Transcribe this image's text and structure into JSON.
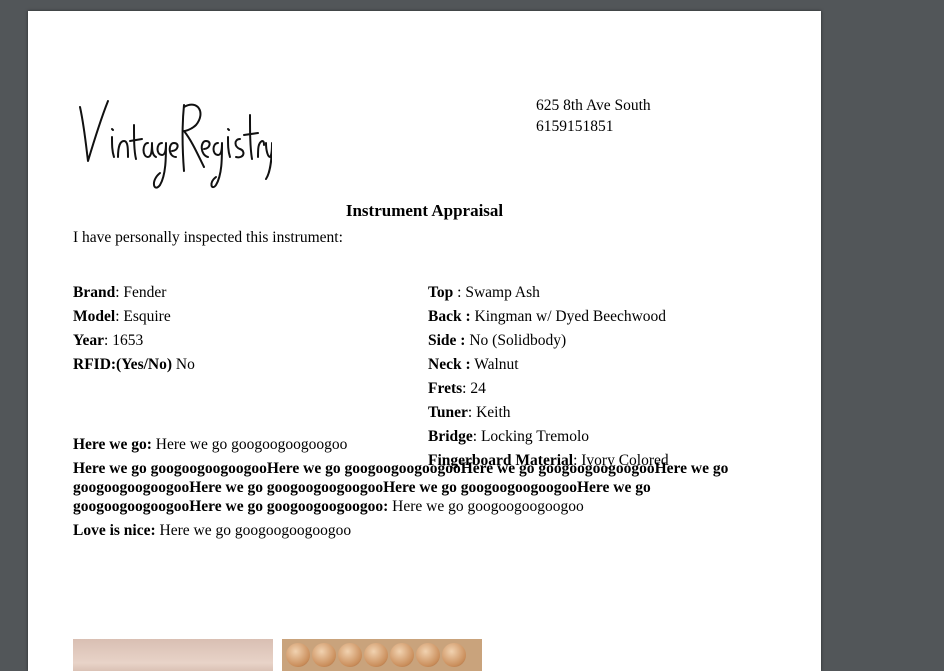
{
  "logo_text": "Vintage Registry",
  "address": {
    "line1": "625 8th Ave South",
    "line2": "6159151851"
  },
  "title": "Instrument Appraisal",
  "intro": "I have personally inspected this instrument:",
  "left_fields": [
    {
      "label": "Brand",
      "sep": ": ",
      "value": "Fender"
    },
    {
      "label": "Model",
      "sep": ": ",
      "value": "Esquire"
    },
    {
      "label": "Year",
      "sep": ": ",
      "value": "1653"
    },
    {
      "label": "RFID:(Yes/No)",
      "sep": " ",
      "value": "No"
    }
  ],
  "right_fields": [
    {
      "label": "Top",
      "sep": " : ",
      "value": "Swamp Ash"
    },
    {
      "label": "Back :",
      "sep": " ",
      "value": "Kingman w/ Dyed Beechwood"
    },
    {
      "label": "Side :",
      "sep": " ",
      "value": "No (Solidbody)"
    },
    {
      "label": "Neck :",
      "sep": " ",
      "value": "Walnut"
    },
    {
      "label": "Frets",
      "sep": ": ",
      "value": "24"
    },
    {
      "label": "Tuner",
      "sep": ": ",
      "value": "Keith"
    },
    {
      "label": "Bridge",
      "sep": ": ",
      "value": "Locking Tremolo"
    },
    {
      "label": "Fingerboard Material",
      "sep": ": ",
      "value": "Ivory Colored"
    }
  ],
  "notes": [
    {
      "label": "Here we go:",
      "value": " Here we go googoogoogoogoo"
    },
    {
      "label": "Here we go googoogoogoogooHere we go googoogoogoogooHere we go googoogoogoogooHere we go googoogoogoogooHere we go googoogoogoogooHere we go googoogoogoogooHere we go googoogoogoogooHere we go googoogoogoogoo:",
      "value": " Here we go googoogoogoogoo"
    },
    {
      "label": "Love is nice:",
      "value": " Here we go googoogoogoogoo"
    }
  ]
}
